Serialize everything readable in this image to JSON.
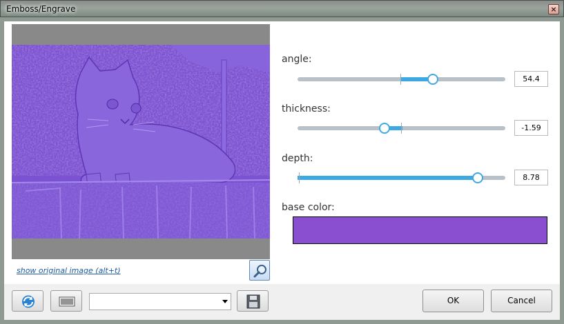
{
  "window": {
    "title": "Emboss/Engrave",
    "close_glyph": "×"
  },
  "preview": {
    "show_original_label": "show original image (alt+t)",
    "zoom_icon": "magnifier-icon",
    "embossed_color": "#7d55d2"
  },
  "params": {
    "angle": {
      "label": "angle:",
      "value": "54.4",
      "fraction": 0.652
    },
    "thickness": {
      "label": "thickness:",
      "value": "-1.59",
      "fraction": 0.42
    },
    "depth": {
      "label": "depth:",
      "value": "8.78",
      "fraction": 0.866
    },
    "base_color": {
      "label": "base color:",
      "color": "#8a4fd0"
    }
  },
  "toolbar": {
    "refresh_icon": "refresh-icon",
    "randomize_icon": "barcode-icon",
    "preset_value": "",
    "save_icon": "save-disk-icon"
  },
  "buttons": {
    "ok_label": "OK",
    "cancel_label": "Cancel"
  }
}
